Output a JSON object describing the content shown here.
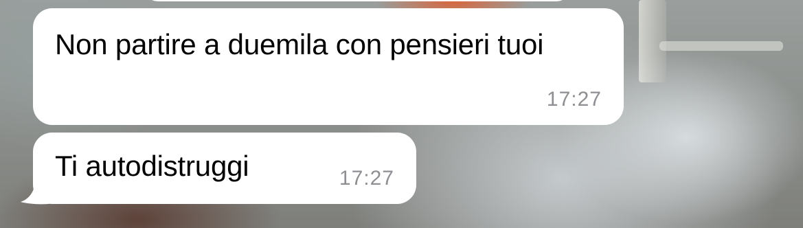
{
  "messages": [
    {
      "text": "Non partire a duemila con pensieri tuoi",
      "time": "17:27"
    },
    {
      "text": "Ti autodistruggi",
      "time": "17:27"
    }
  ],
  "colors": {
    "bubble": "#ffffff",
    "text": "#000000",
    "time": "#8e8e93"
  }
}
